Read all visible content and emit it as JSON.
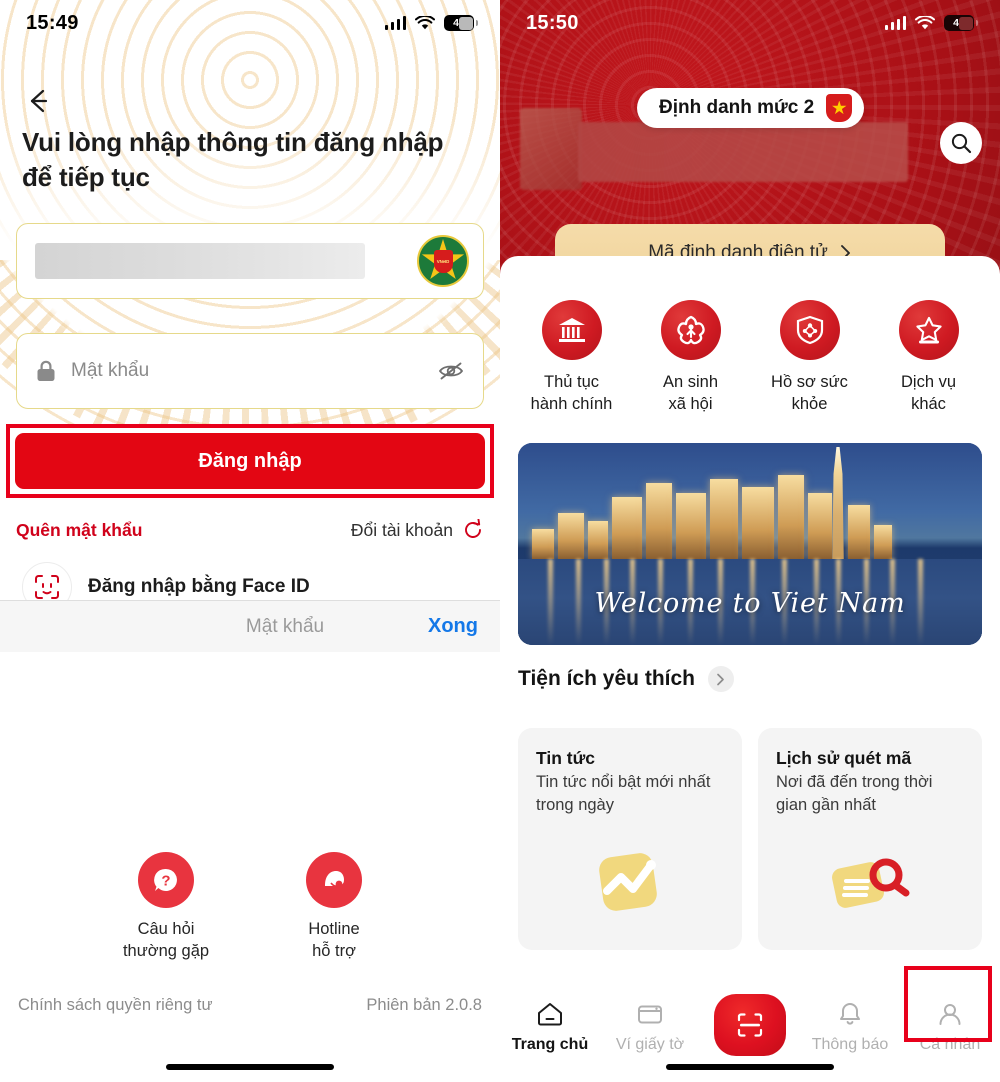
{
  "left_screen": {
    "status_bar": {
      "time": "15:49",
      "battery_level": "42",
      "signal_icon": "cellular-signal-icon",
      "wifi_icon": "wifi-icon"
    },
    "back_icon": "back-arrow-icon",
    "title": "Vui lòng nhập thông tin đăng nhập để tiếp tục",
    "username_field": {
      "value_redacted": true,
      "logo_icon": "vneid-logo-icon",
      "logo_text": "VNeID"
    },
    "password_field": {
      "placeholder": "Mật khẩu",
      "lock_icon": "lock-icon",
      "eye_icon": "eye-off-icon"
    },
    "login_button": {
      "label": "Đăng nhập",
      "highlight_color": "#e8001b",
      "bg_color": "#e30613"
    },
    "forgot_password": "Quên mật khẩu",
    "switch_account": {
      "label": "Đổi tài khoản",
      "icon": "refresh-icon"
    },
    "faceid_login": {
      "label": "Đăng nhập bằng Face ID",
      "icon": "face-id-icon"
    },
    "keyboard_bar": {
      "hint": "Mật khẩu",
      "done_label": "Xong",
      "done_color": "#1478e8"
    },
    "help": [
      {
        "label": "Câu hỏi\nthường gặp",
        "line1": "Câu hỏi",
        "line2": "thường gặp",
        "icon": "faq-question-icon"
      },
      {
        "label": "Hotline\nhỗ trợ",
        "line1": "Hotline",
        "line2": "hỗ trợ",
        "icon": "hotline-support-icon"
      }
    ],
    "footer": {
      "privacy": "Chính sách quyền riêng tư",
      "version": "Phiên bản 2.0.8"
    }
  },
  "right_screen": {
    "status_bar": {
      "time": "15:50",
      "battery_level": "41",
      "signal_icon": "cellular-signal-icon",
      "wifi_icon": "wifi-icon"
    },
    "identity_badge": {
      "label": "Định danh mức 2",
      "icon": "shield-star-icon"
    },
    "profile": {
      "avatar_redacted": true,
      "name_redacted": true
    },
    "search_icon": "search-icon",
    "eid_card": {
      "label": "Mã định danh điện tử",
      "chevron": "chevron-right-icon"
    },
    "quick_actions": [
      {
        "line1": "Thủ tục",
        "line2": "hành chính",
        "icon": "government-building-icon"
      },
      {
        "line1": "An sinh",
        "line2": "xã hội",
        "icon": "social-welfare-flower-icon"
      },
      {
        "line1": "Hồ sơ sức",
        "line2": "khỏe",
        "icon": "health-shield-icon"
      },
      {
        "line1": "Dịch vụ",
        "line2": "khác",
        "icon": "star-services-icon"
      }
    ],
    "banner": {
      "caption": "Welcome to Viet Nam",
      "alt": "vietnam-city-skyline-night"
    },
    "favorites_header": {
      "title": "Tiện ích yêu thích",
      "chevron": "chevron-right-icon"
    },
    "cards": [
      {
        "title": "Tin tức",
        "desc": "Tin tức nổi bật mới nhất trong ngày",
        "icon": "news-chart-icon"
      },
      {
        "title": "Lịch sử quét mã",
        "desc": "Nơi đã đến trong thời gian gần nhất",
        "icon": "scan-history-magnifier-icon"
      }
    ],
    "tabbar": [
      {
        "label": "Trang chủ",
        "icon": "home-icon",
        "active": true
      },
      {
        "label": "Ví giấy tờ",
        "icon": "wallet-icon",
        "active": false
      },
      {
        "label": "",
        "icon": "scan-qr-icon",
        "active": false
      },
      {
        "label": "Thông báo",
        "icon": "bell-icon",
        "active": false
      },
      {
        "label": "Cá nhân",
        "icon": "person-icon",
        "active": false,
        "highlighted": true
      }
    ],
    "highlight_color": "#e8001b"
  }
}
